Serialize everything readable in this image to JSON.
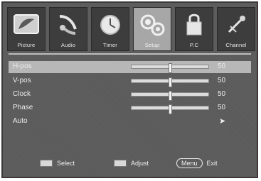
{
  "tabs": [
    {
      "label": "Picture",
      "icon": "picture-icon",
      "active": false
    },
    {
      "label": "Audio",
      "icon": "audio-icon",
      "active": false
    },
    {
      "label": "Timer",
      "icon": "timer-icon",
      "active": false
    },
    {
      "label": "Setup",
      "icon": "setup-icon",
      "active": true
    },
    {
      "label": "P.C",
      "icon": "pc-icon",
      "active": false
    },
    {
      "label": "Channel",
      "icon": "channel-icon",
      "active": false
    }
  ],
  "settings": [
    {
      "label": "H-pos",
      "value": "50",
      "level": 0.5,
      "selected": true
    },
    {
      "label": "V-pos",
      "value": "50",
      "level": 0.5,
      "selected": false
    },
    {
      "label": "Clock",
      "value": "50",
      "level": 0.5,
      "selected": false
    },
    {
      "label": "Phase",
      "value": "50",
      "level": 0.5,
      "selected": false
    },
    {
      "label": "Auto",
      "action_icon": "arrow-right-icon",
      "arrow_glyph": "➤",
      "selected": false
    }
  ],
  "footer": {
    "select_label": "Select",
    "select_icon": "select-keys-icon",
    "adjust_label": "Adjust",
    "adjust_icon": "adjust-keys-icon",
    "menu_key": "Menu",
    "exit_label": "Exit"
  }
}
